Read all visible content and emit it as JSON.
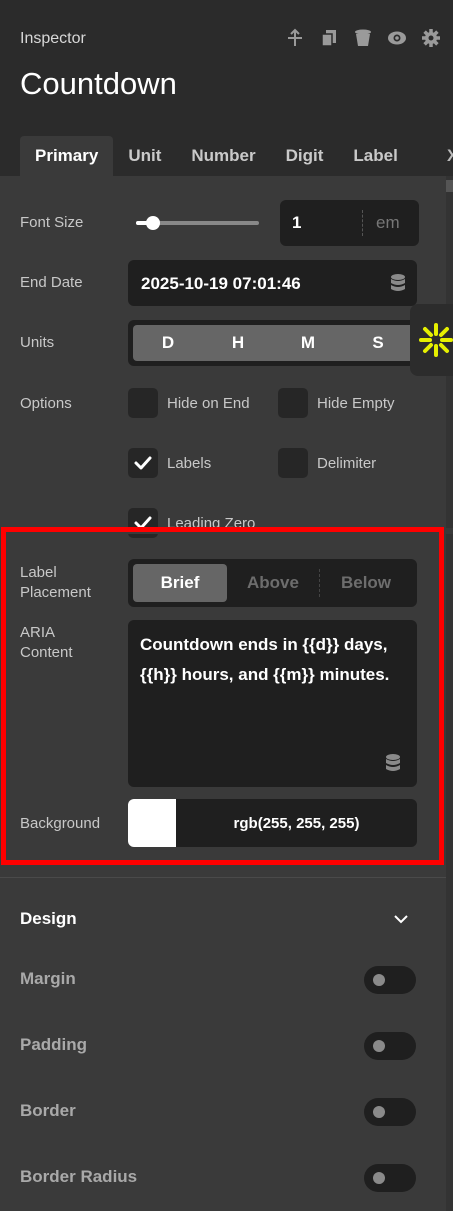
{
  "header": {
    "inspector_label": "Inspector",
    "title": "Countdown",
    "icons": [
      "pin-icon",
      "copy-icon",
      "delete-icon",
      "visibility-icon",
      "settings-icon"
    ]
  },
  "tabs": [
    {
      "label": "Primary",
      "active": true
    },
    {
      "label": "Unit",
      "active": false
    },
    {
      "label": "Number",
      "active": false
    },
    {
      "label": "Digit",
      "active": false
    },
    {
      "label": "Label",
      "active": false
    }
  ],
  "tabs_overflow": "X",
  "font_size": {
    "label": "Font Size",
    "value": "1",
    "unit": "em",
    "slider_level": 0.1
  },
  "end_date": {
    "label": "End Date",
    "value": "2025-10-19 07:01:46"
  },
  "units": {
    "label": "Units",
    "options": [
      "D",
      "H",
      "M",
      "S"
    ]
  },
  "options": {
    "label": "Options",
    "items": [
      {
        "label": "Hide on End",
        "checked": false
      },
      {
        "label": "Hide Empty",
        "checked": false
      },
      {
        "label": "Labels",
        "checked": true
      },
      {
        "label": "Delimiter",
        "checked": false
      },
      {
        "label": "Leading Zero",
        "checked": true
      }
    ]
  },
  "label_placement": {
    "label_line1": "Label",
    "label_line2": "Placement",
    "options": [
      "Brief",
      "Above",
      "Below"
    ],
    "selected": "Brief"
  },
  "aria_content": {
    "label_line1": "ARIA",
    "label_line2": "Content",
    "value": "Countdown ends in {{d}} days, {{h}} hours, and {{m}} minutes."
  },
  "background": {
    "label": "Background",
    "value": "rgb(255, 255, 255)",
    "swatch_color": "#ffffff"
  },
  "design": {
    "title": "Design",
    "properties": [
      {
        "label": "Margin",
        "enabled": false
      },
      {
        "label": "Padding",
        "enabled": false
      },
      {
        "label": "Border",
        "enabled": false
      },
      {
        "label": "Border Radius",
        "enabled": false
      }
    ]
  },
  "colors": {
    "highlight": "#ff0000",
    "badge_accent": "#e6f000",
    "panel": "#3a3a3a",
    "field": "#1f1f1f"
  }
}
